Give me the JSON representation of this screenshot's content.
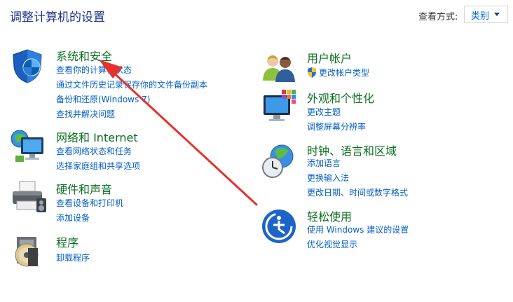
{
  "page": {
    "title": "调整计算机的设置"
  },
  "view_by": {
    "label": "查看方式:",
    "value": "类别"
  },
  "left_column": [
    {
      "title": "系统和安全",
      "icon": "shield-icon",
      "links": [
        "查看你的计算机状态",
        "通过文件历史记录保存你的文件备份副本",
        "备份和还原(Windows 7)",
        "查找并解决问题"
      ]
    },
    {
      "title": "网络和 Internet",
      "icon": "network-globe-icon",
      "links": [
        "查看网络状态和任务",
        "选择家庭组和共享选项"
      ]
    },
    {
      "title": "硬件和声音",
      "icon": "printer-icon",
      "links": [
        "查看设备和打印机",
        "添加设备"
      ]
    },
    {
      "title": "程序",
      "icon": "programs-disc-icon",
      "links": [
        "卸载程序"
      ]
    }
  ],
  "right_column": [
    {
      "title": "用户帐户",
      "icon": "users-icon",
      "links": [
        "更改帐户类型"
      ]
    },
    {
      "title": "外观和个性化",
      "icon": "monitor-palette-icon",
      "links": [
        "更改主题",
        "调整屏幕分辨率"
      ]
    },
    {
      "title": "时钟、语言和区域",
      "icon": "clock-globe-icon",
      "links": [
        "添加语言",
        "更换输入法",
        "更改日期、时间或数字格式"
      ]
    },
    {
      "title": "轻松使用",
      "icon": "ease-of-access-icon",
      "links": [
        "使用 Windows 建议的设置",
        "优化视觉显示"
      ]
    }
  ],
  "annotation": {
    "arrow_color": "#e5322d"
  }
}
